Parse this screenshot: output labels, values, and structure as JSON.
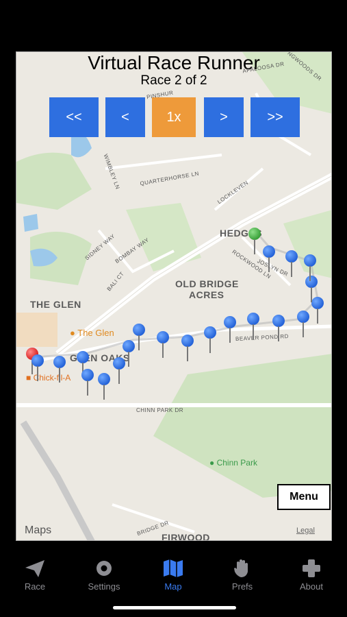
{
  "header": {
    "title": "Virtual Race Runner",
    "subtitle": "Race 2 of 2"
  },
  "controls": {
    "rewind_full": "<<",
    "rewind": "<",
    "speed": "1x",
    "forward": ">",
    "forward_full": ">>"
  },
  "map": {
    "areas": {
      "hedges": "HEDGES",
      "old_bridge_1": "OLD BRIDGE",
      "old_bridge_2": "ACRES",
      "the_glen": "THE GLEN",
      "glen_oaks": "GLEN OAKS",
      "firwood": "FIRWOOD"
    },
    "streets": {
      "quarterhorse": "QUARTERHORSE LN",
      "wimbley": "WIMBLEY LN",
      "locklevin": "LOCKLEVEN",
      "sidney": "SIDNEY WAY",
      "bombay": "BOMBAY WAY",
      "bali": "BALI CT",
      "rockwood": "ROCKWOOD LN",
      "joslyn": "JOSLYN DR",
      "beaver_pond": "BEAVER POND RD",
      "chinn_park_dr": "CHINN PARK DR",
      "bridge": "BRIDGE DR",
      "palooza": "APALOOSA DR",
      "woods": "NGWOODS DR",
      "pinshur": "PINSHUR"
    },
    "pois": {
      "the_glen": "The Glen",
      "chick": "Chick-fil-A",
      "chinn_park": "Chinn Park"
    },
    "menu_label": "Menu",
    "maps_label": "Maps",
    "legal_label": "Legal"
  },
  "tabs": [
    {
      "label": "Race",
      "icon": "paper-plane-icon"
    },
    {
      "label": "Settings",
      "icon": "gear-icon"
    },
    {
      "label": "Map",
      "icon": "map-icon",
      "active": true
    },
    {
      "label": "Prefs",
      "icon": "hand-icon"
    },
    {
      "label": "About",
      "icon": "plus-icon"
    }
  ],
  "colors": {
    "accent": "#3a7bf0",
    "control_blue": "#2e6fe0",
    "speed_orange": "#ee9a3a"
  }
}
